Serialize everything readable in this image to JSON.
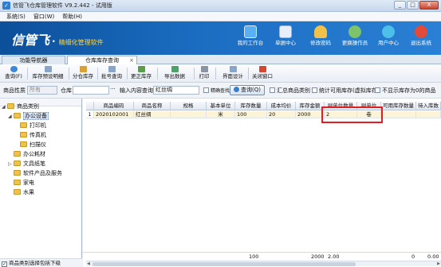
{
  "window": {
    "title": "信管飞仓库管理软件 V9.2.442 - 试用版",
    "buttons": [
      "_",
      "□",
      "X"
    ]
  },
  "menu": [
    "系统(S)",
    "窗口(W)",
    "帮助(H)"
  ],
  "banner": {
    "logo_mark": "信管飞",
    "logo_dot": "·",
    "slogan": "精细化管理软件",
    "nav": [
      {
        "label": "我的工作台",
        "icon": "monitor-icon",
        "color": "#5ab0f2"
      },
      {
        "label": "单据中心",
        "icon": "document-icon",
        "color": "#e8eef8"
      },
      {
        "label": "修改密码",
        "icon": "lock-icon",
        "color": "#f2c14a"
      },
      {
        "label": "更换操作员",
        "icon": "users-icon",
        "color": "#7cc36a"
      },
      {
        "label": "用户中心",
        "icon": "globe-icon",
        "color": "#4cc0e8"
      },
      {
        "label": "退出系统",
        "icon": "power-icon",
        "color": "#e24a3a"
      }
    ]
  },
  "tabs": [
    {
      "label": "功能导航器",
      "active": false
    },
    {
      "label": "仓库库存查询",
      "active": true,
      "close": "×"
    }
  ],
  "toolbar": [
    {
      "label": "查询(F)",
      "icon": "refresh-icon",
      "color": "#3d87d6"
    },
    {
      "label": "库存预设明细",
      "icon": "list-icon",
      "color": "#8aa5c5"
    },
    {
      "label": "分仓库存",
      "icon": "warehouse-icon",
      "color": "#d6a23a"
    },
    {
      "label": "批号查询",
      "icon": "barcode-icon",
      "color": "#8aa5c5"
    },
    {
      "label": "更正库存",
      "icon": "edit-icon",
      "color": "#5a9e4a"
    },
    {
      "label": "导出数据",
      "icon": "export-icon",
      "color": "#4aa36a"
    },
    {
      "label": "打印",
      "icon": "printer-icon",
      "color": "#8a94a2"
    },
    {
      "label": "界面设计",
      "icon": "design-icon",
      "color": "#8aa5c5"
    },
    {
      "label": "关闭窗口",
      "icon": "close-window-icon",
      "color": "#d9452e"
    }
  ],
  "filters": {
    "attr_label": "商品性质",
    "attr_value": "所有",
    "warehouse_label": "仓库",
    "warehouse_value": "",
    "search_label": "输入内容查询",
    "search_value": "红丝绸",
    "exact_label": "精确查找",
    "query_button": "查询(Q)",
    "check1": "汇总商品类别",
    "check2": "统计可用库存(虚拟库存)",
    "check3": "不显示库存为0的商品"
  },
  "tree": {
    "header": "",
    "items": [
      {
        "label": "商品类别",
        "level": 0,
        "expander": "◢"
      },
      {
        "label": "办公设备",
        "level": 1,
        "expander": "◢",
        "selected": true
      },
      {
        "label": "打印机",
        "level": 2
      },
      {
        "label": "传真机",
        "level": 2
      },
      {
        "label": "扫描仪",
        "level": 2
      },
      {
        "label": "办公耗材",
        "level": 1
      },
      {
        "label": "文具纸笔",
        "level": 1,
        "expander": "▷"
      },
      {
        "label": "软件产品及服务",
        "level": 1
      },
      {
        "label": "家电",
        "level": 1
      },
      {
        "label": "水果",
        "level": 1
      }
    ],
    "footer": "商品类别选择包括下级",
    "footer_checked": "✓"
  },
  "grid": {
    "columns": [
      "",
      "商品编码",
      "商品名称",
      "规格",
      "基本单位",
      "库存数量",
      "成本均价",
      "库存金额",
      "副单位数量",
      "副单位",
      "可用库存数量",
      "待入库数"
    ],
    "rows": [
      [
        "1",
        "2020102001",
        "红丝绸",
        "",
        "米",
        "100",
        "20",
        "2000",
        "2",
        "卷",
        "",
        ""
      ]
    ],
    "summary": {
      "qty": "100",
      "amount": "2000",
      "sub_qty": "2.00",
      "avail": "0",
      "pending": "0.00"
    }
  }
}
